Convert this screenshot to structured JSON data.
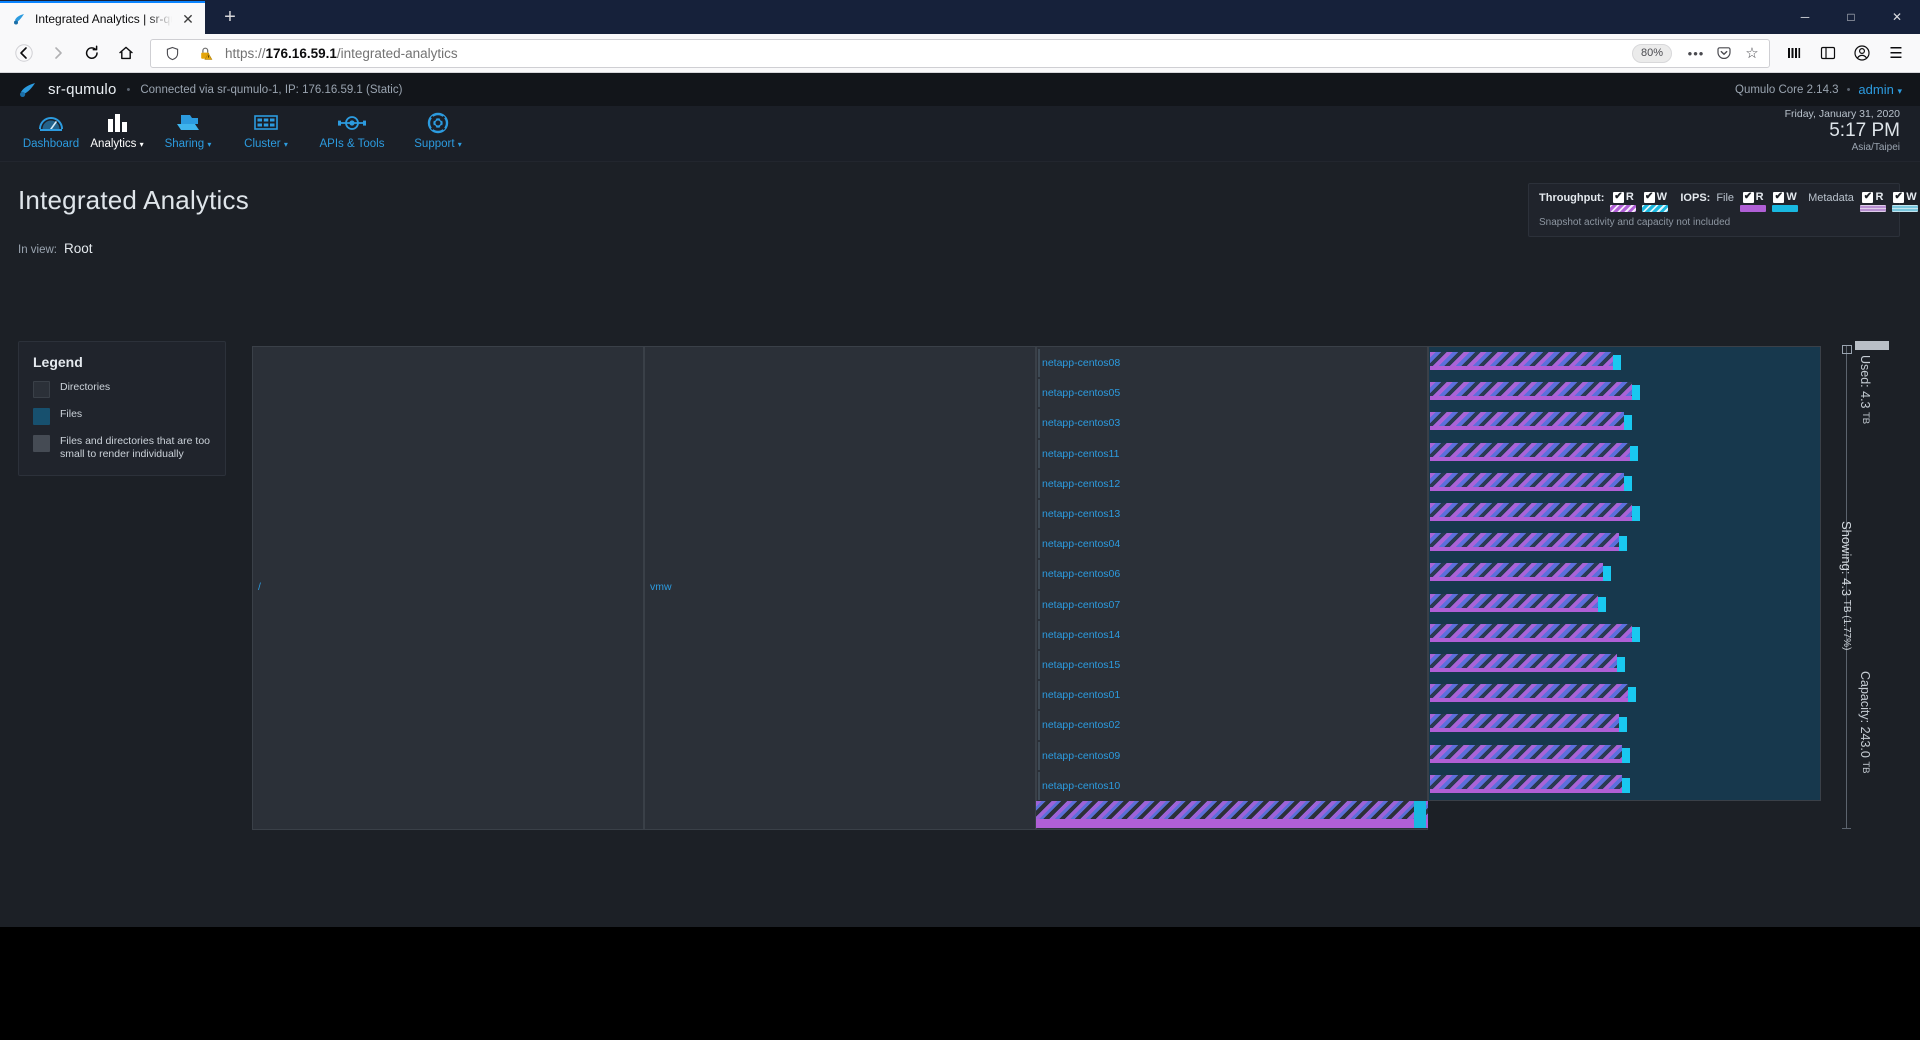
{
  "browser": {
    "tab": {
      "title": "Integrated Analytics | sr-qumul",
      "close_label": "✕",
      "favicon": "qumulo-favicon"
    },
    "new_tab_label": "+",
    "window_controls": {
      "minimize": "─",
      "maximize": "□",
      "close": "✕"
    },
    "toolbar": {
      "back": "←",
      "forward": "→",
      "reload": "↻",
      "home": "⌂",
      "shield_icon": "tracking-protection-shield",
      "lock_icon": "padlock-warning",
      "url_prefix": "https://",
      "url_host": "176.16.59.1",
      "url_path": "/integrated-analytics",
      "zoom_level": "80%",
      "more_actions": "•••",
      "pocket": "save-to-pocket",
      "bookmark": "☆",
      "library": "library-icon",
      "sidebar": "sidebar-icon",
      "account": "account-icon",
      "menu": "☰"
    }
  },
  "app": {
    "topbar": {
      "brand": "sr-qumulo",
      "separator": "•",
      "connection": "Connected via sr-qumulo-1, IP: 176.16.59.1 (Static)",
      "core_version": "Qumulo Core 2.14.3",
      "user": "admin",
      "user_caret": "▾"
    },
    "nav": [
      {
        "label": "Dashboard",
        "icon": "gauge-icon",
        "active": false,
        "caret": ""
      },
      {
        "label": "Analytics",
        "icon": "bar-chart-icon",
        "active": true,
        "caret": "▾"
      },
      {
        "label": "Sharing",
        "icon": "share-folder-icon",
        "active": false,
        "caret": "▾"
      },
      {
        "label": "Cluster",
        "icon": "server-rack-icon",
        "active": false,
        "caret": "▾"
      },
      {
        "label": "APIs & Tools",
        "icon": "api-node-icon",
        "active": false,
        "caret": ""
      },
      {
        "label": "Support",
        "icon": "lifering-icon",
        "active": false,
        "caret": "▾"
      }
    ],
    "clock": {
      "date": "Friday, January 31, 2020",
      "time": "5:17 PM",
      "timezone": "Asia/Taipei"
    },
    "page_title": "Integrated Analytics",
    "in_view": {
      "label": "In view:",
      "value": "Root"
    },
    "activity_legend": {
      "throughput_label": "Throughput:",
      "iops_label": "IOPS:",
      "file_label": "File",
      "metadata_label": "Metadata",
      "read_label": "R",
      "write_label": "W",
      "checkmark": "✔",
      "note": "Snapshot activity and capacity not included",
      "colors": {
        "read": "#b05fd6",
        "write": "#19b8e0"
      }
    },
    "legend_card": {
      "title": "Legend",
      "items": [
        {
          "label": "Directories",
          "color": "#2b3038"
        },
        {
          "label": "Files",
          "color": "#17506e"
        },
        {
          "label": "Files and directories that are too small to render individually",
          "color": "#454b54"
        }
      ]
    },
    "treemap": {
      "cells": [
        {
          "name": "root-directory",
          "label": "/"
        },
        {
          "name": "vmw-directory",
          "label": "vmw"
        }
      ],
      "file_entries": [
        {
          "label": "netapp-centos08",
          "bar_width_pct": 91
        },
        {
          "label": "netapp-centos05",
          "bar_width_pct": 100
        },
        {
          "label": "netapp-centos03",
          "bar_width_pct": 96
        },
        {
          "label": "netapp-centos11",
          "bar_width_pct": 99
        },
        {
          "label": "netapp-centos12",
          "bar_width_pct": 96
        },
        {
          "label": "netapp-centos13",
          "bar_width_pct": 100
        },
        {
          "label": "netapp-centos04",
          "bar_width_pct": 94
        },
        {
          "label": "netapp-centos06",
          "bar_width_pct": 86
        },
        {
          "label": "netapp-centos07",
          "bar_width_pct": 84
        },
        {
          "label": "netapp-centos14",
          "bar_width_pct": 100
        },
        {
          "label": "netapp-centos15",
          "bar_width_pct": 93
        },
        {
          "label": "netapp-centos01",
          "bar_width_pct": 98
        },
        {
          "label": "netapp-centos02",
          "bar_width_pct": 94
        },
        {
          "label": "netapp-centos09",
          "bar_width_pct": 95
        },
        {
          "label": "netapp-centos10",
          "bar_width_pct": 95
        }
      ]
    },
    "capacity": {
      "used": "Used: 4.3",
      "used_unit": "TB",
      "showing": "Showing: 4.3",
      "showing_unit": "TB (1.77%)",
      "capacity": "Capacity: 243.0",
      "capacity_unit": "TB"
    }
  }
}
